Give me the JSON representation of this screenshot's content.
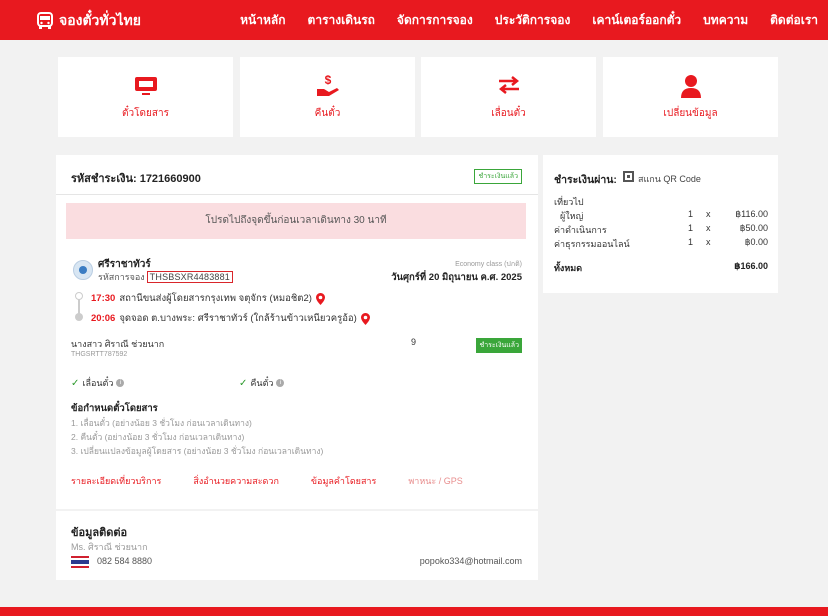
{
  "nav": {
    "brand": "จองตั๋วทั่วไทย",
    "items": [
      "หน้าหลัก",
      "ตารางเดินรถ",
      "จัดการการจอง",
      "ประวัติการจอง",
      "เคาน์เตอร์ออกตั๋ว",
      "บทความ",
      "ติดต่อเรา"
    ]
  },
  "actions": [
    {
      "label": "ตั๋วโดยสาร",
      "icon": "ticket-icon"
    },
    {
      "label": "คืนตั๋ว",
      "icon": "refund-hand-icon"
    },
    {
      "label": "เลื่อนตั๋ว",
      "icon": "swap-arrows-icon"
    },
    {
      "label": "เปลี่ยนข้อมูล",
      "icon": "user-icon"
    }
  ],
  "booking": {
    "payment_code_label": "รหัสชำระเงิน: 1721660900",
    "payment_status": "ชำระเงินแล้ว",
    "notice": "โปรดไปถึงจุดขึ้นก่อนเวลาเดินทาง 30 นาที",
    "operator": "ศรีราชาทัวร์",
    "booking_code_label": "รหัสการจอง",
    "booking_code": "THSBSXR4483881",
    "class": "Economy class (ปกติ)",
    "date": "วันศุกร์ที่ 20 มิถุนายน ค.ศ. 2025",
    "stops": [
      {
        "time": "17:30",
        "place": "สถานีขนส่งผู้โดยสารกรุงเทพ จตุจักร (หมอชิต2)"
      },
      {
        "time": "20:06",
        "place": "จุดจอด ต.บางพระ: ศรีราชาทัวร์ (ใกล้ร้านข้าวเหนียวครูอ้อ)"
      }
    ],
    "passenger": {
      "name": "นางสาว ศิราณี ช่วยนาก",
      "ticket_id": "THGSRTT787592",
      "seat": "9",
      "status": "ชำระเงินแล้ว"
    },
    "features": [
      "เลื่อนตั๋ว",
      "คืนตั๋ว"
    ],
    "rules_title": "ข้อกำหนดตั๋วโดยสาร",
    "rules": [
      "1. เลื่อนตั๋ว (อย่างน้อย 3 ชั่วโมง ก่อนเวลาเดินทาง)",
      "2. คืนตั๋ว (อย่างน้อย 3 ชั่วโมง ก่อนเวลาเดินทาง)",
      "3. เปลี่ยนแปลงข้อมูลผู้โดยสาร (อย่างน้อย 3 ชั่วโมง ก่อนเวลาเดินทาง)"
    ],
    "links": [
      "รายละเอียดเที่ยวบริการ",
      "สิ่งอำนวยความสะดวก",
      "ข้อมูลคำโดยสาร",
      "พาหนะ / GPS"
    ]
  },
  "contact": {
    "title": "ข้อมูลติดต่อ",
    "name": "Ms. ศิราณี ช่วยนาก",
    "phone": "082 584 8880",
    "email": "popoko334@hotmail.com"
  },
  "payment": {
    "title": "ชำระเงินผ่าน:",
    "method": "สแกน QR Code",
    "trip_label": "เที่ยวไป",
    "lines": [
      {
        "label": "ผู้ใหญ่",
        "qty": "1",
        "x": "x",
        "amount": "฿116.00"
      },
      {
        "label": "ค่าดำเนินการ",
        "qty": "1",
        "x": "x",
        "amount": "฿50.00"
      },
      {
        "label": "ค่าธุรกรรมออนไลน์",
        "qty": "1",
        "x": "x",
        "amount": "฿0.00"
      }
    ],
    "total_label": "ทั้งหมด",
    "total": "฿166.00"
  },
  "colors": {
    "brand": "#e8191f",
    "success": "#3aa63a"
  }
}
